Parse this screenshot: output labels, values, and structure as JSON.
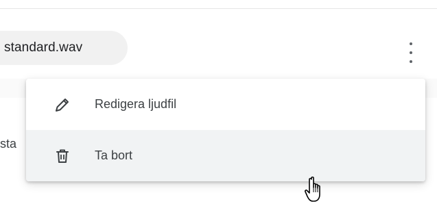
{
  "file_row": {
    "filename": "standard.wav",
    "more_icon": "more-vert-icon"
  },
  "second_row": {
    "partial_text": "sta"
  },
  "context_menu": {
    "items": [
      {
        "label": "Redigera ljudfil",
        "icon": "pencil-icon"
      },
      {
        "label": "Ta bort",
        "icon": "trash-icon",
        "hovered": true
      }
    ]
  },
  "cursor": {
    "icon": "hand-pointer-icon"
  }
}
